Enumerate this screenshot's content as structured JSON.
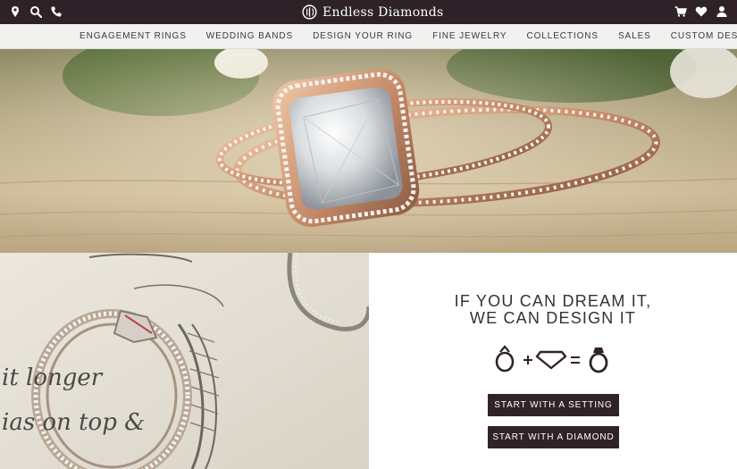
{
  "topbar": {
    "left_icons": [
      "location-pin-icon",
      "search-icon",
      "phone-icon"
    ],
    "right_icons": [
      "cart-icon",
      "heart-icon",
      "user-icon"
    ],
    "logo_text": "Endless Diamonds",
    "background": "#2e2228"
  },
  "nav": {
    "items": [
      {
        "label": "ENGAGEMENT RINGS"
      },
      {
        "label": "WEDDING BANDS"
      },
      {
        "label": "DESIGN YOUR RING"
      },
      {
        "label": "FINE JEWELRY"
      },
      {
        "label": "COLLECTIONS"
      },
      {
        "label": "SALES"
      },
      {
        "label": "CUSTOM DESIGN"
      }
    ]
  },
  "cta": {
    "title_line1": "IF YOU CAN DREAM IT,",
    "title_line2": "WE CAN DESIGN IT",
    "equation_icons": [
      "ring-setting-icon",
      "plus-icon",
      "diamond-icon",
      "equals-icon",
      "finished-ring-icon"
    ],
    "button_setting": "START WITH A SETTING",
    "button_diamond": "START WITH A DIAMOND"
  },
  "sketch_handwriting": {
    "line1": "it longer",
    "line2": "ias on top &"
  }
}
